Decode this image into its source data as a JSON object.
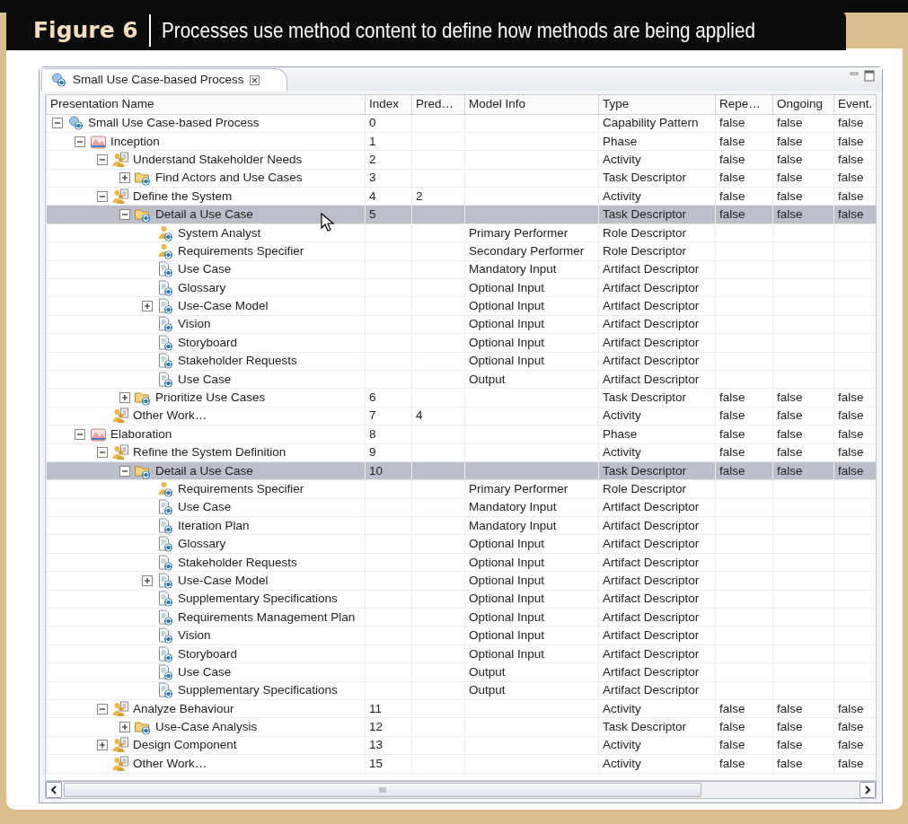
{
  "figure": {
    "label": "Figure 6",
    "caption": "Processes use method content to define how methods are being applied"
  },
  "editor_tab": {
    "title": "Small Use Case-based Process",
    "selected": true
  },
  "columns": [
    "Presentation Name",
    "Index",
    "Pred…",
    "Model Info",
    "Type",
    "Repe…",
    "Ongoing",
    "Event."
  ],
  "tree": [
    {
      "name": "Small Use Case-based Process",
      "kind": "process",
      "index": "0",
      "type": "Capability Pattern",
      "repeatable": "false",
      "ongoing": "false",
      "event": "false",
      "expanded": true,
      "selected": false,
      "children": [
        {
          "name": "Inception",
          "kind": "phase",
          "index": "1",
          "type": "Phase",
          "repeatable": "false",
          "ongoing": "false",
          "event": "false",
          "expanded": true,
          "selected": false,
          "children": [
            {
              "name": "Understand Stakeholder Needs",
              "kind": "activity",
              "index": "2",
              "type": "Activity",
              "repeatable": "false",
              "ongoing": "false",
              "event": "false",
              "expanded": true,
              "selected": false,
              "children": [
                {
                  "name": "Find Actors and Use Cases",
                  "kind": "task",
                  "index": "3",
                  "type": "Task Descriptor",
                  "repeatable": "false",
                  "ongoing": "false",
                  "event": "false",
                  "expanded": false,
                  "selected": false
                }
              ]
            },
            {
              "name": "Define the System",
              "kind": "activity",
              "index": "4",
              "pred": "2",
              "type": "Activity",
              "repeatable": "false",
              "ongoing": "false",
              "event": "false",
              "expanded": true,
              "selected": false,
              "children": [
                {
                  "name": "Detail a Use Case",
                  "kind": "task",
                  "index": "5",
                  "type": "Task Descriptor",
                  "repeatable": "false",
                  "ongoing": "false",
                  "event": "false",
                  "expanded": true,
                  "selected": true,
                  "children": [
                    {
                      "name": "System Analyst",
                      "kind": "role",
                      "model_info": "Primary Performer",
                      "type": "Role Descriptor",
                      "selected": false
                    },
                    {
                      "name": "Requirements Specifier",
                      "kind": "role",
                      "model_info": "Secondary Performer",
                      "type": "Role Descriptor",
                      "selected": false
                    },
                    {
                      "name": "Use Case",
                      "kind": "artifact",
                      "model_info": "Mandatory Input",
                      "type": "Artifact Descriptor",
                      "selected": false
                    },
                    {
                      "name": "Glossary",
                      "kind": "artifact",
                      "model_info": "Optional Input",
                      "type": "Artifact Descriptor",
                      "selected": false
                    },
                    {
                      "name": "Use-Case Model",
                      "kind": "artifact",
                      "model_info": "Optional Input",
                      "type": "Artifact Descriptor",
                      "expanded": false,
                      "selected": false
                    },
                    {
                      "name": "Vision",
                      "kind": "artifact",
                      "model_info": "Optional Input",
                      "type": "Artifact Descriptor",
                      "selected": false
                    },
                    {
                      "name": "Storyboard",
                      "kind": "artifact",
                      "model_info": "Optional Input",
                      "type": "Artifact Descriptor",
                      "selected": false
                    },
                    {
                      "name": "Stakeholder Requests",
                      "kind": "artifact",
                      "model_info": "Optional Input",
                      "type": "Artifact Descriptor",
                      "selected": false
                    },
                    {
                      "name": "Use Case",
                      "kind": "artifact",
                      "model_info": "Output",
                      "type": "Artifact Descriptor",
                      "selected": false
                    }
                  ]
                },
                {
                  "name": "Prioritize Use Cases",
                  "kind": "task",
                  "index": "6",
                  "type": "Task Descriptor",
                  "repeatable": "false",
                  "ongoing": "false",
                  "event": "false",
                  "expanded": false,
                  "selected": false
                }
              ]
            },
            {
              "name": "Other Work…",
              "kind": "activity",
              "index": "7",
              "pred": "4",
              "type": "Activity",
              "repeatable": "false",
              "ongoing": "false",
              "event": "false",
              "selected": false
            }
          ]
        },
        {
          "name": "Elaboration",
          "kind": "phase",
          "index": "8",
          "type": "Phase",
          "repeatable": "false",
          "ongoing": "false",
          "event": "false",
          "expanded": true,
          "selected": false,
          "children": [
            {
              "name": "Refine the System Definition",
              "kind": "activity",
              "index": "9",
              "type": "Activity",
              "repeatable": "false",
              "ongoing": "false",
              "event": "false",
              "expanded": true,
              "selected": false,
              "children": [
                {
                  "name": "Detail a Use Case",
                  "kind": "task",
                  "index": "10",
                  "type": "Task Descriptor",
                  "repeatable": "false",
                  "ongoing": "false",
                  "event": "false",
                  "expanded": true,
                  "selected": true,
                  "children": [
                    {
                      "name": "Requirements Specifier",
                      "kind": "role",
                      "model_info": "Primary Performer",
                      "type": "Role Descriptor",
                      "selected": false
                    },
                    {
                      "name": "Use Case",
                      "kind": "artifact",
                      "model_info": "Mandatory Input",
                      "type": "Artifact Descriptor",
                      "selected": false
                    },
                    {
                      "name": "Iteration Plan",
                      "kind": "artifact",
                      "model_info": "Mandatory Input",
                      "type": "Artifact Descriptor",
                      "selected": false
                    },
                    {
                      "name": "Glossary",
                      "kind": "artifact",
                      "model_info": "Optional Input",
                      "type": "Artifact Descriptor",
                      "selected": false
                    },
                    {
                      "name": "Stakeholder Requests",
                      "kind": "artifact",
                      "model_info": "Optional Input",
                      "type": "Artifact Descriptor",
                      "selected": false
                    },
                    {
                      "name": "Use-Case Model",
                      "kind": "artifact",
                      "model_info": "Optional Input",
                      "type": "Artifact Descriptor",
                      "expanded": false,
                      "selected": false
                    },
                    {
                      "name": "Supplementary Specifications",
                      "kind": "artifact",
                      "model_info": "Optional Input",
                      "type": "Artifact Descriptor",
                      "selected": false
                    },
                    {
                      "name": "Requirements Management Plan",
                      "kind": "artifact",
                      "model_info": "Optional Input",
                      "type": "Artifact Descriptor",
                      "selected": false
                    },
                    {
                      "name": "Vision",
                      "kind": "artifact",
                      "model_info": "Optional Input",
                      "type": "Artifact Descriptor",
                      "selected": false
                    },
                    {
                      "name": "Storyboard",
                      "kind": "artifact",
                      "model_info": "Optional Input",
                      "type": "Artifact Descriptor",
                      "selected": false
                    },
                    {
                      "name": "Use Case",
                      "kind": "artifact",
                      "model_info": "Output",
                      "type": "Artifact Descriptor",
                      "selected": false
                    },
                    {
                      "name": "Supplementary Specifications",
                      "kind": "artifact",
                      "model_info": "Output",
                      "type": "Artifact Descriptor",
                      "selected": false
                    }
                  ]
                }
              ]
            },
            {
              "name": "Analyze Behaviour",
              "kind": "activity",
              "index": "11",
              "type": "Activity",
              "repeatable": "false",
              "ongoing": "false",
              "event": "false",
              "expanded": true,
              "selected": false,
              "children": [
                {
                  "name": "Use-Case Analysis",
                  "kind": "task",
                  "index": "12",
                  "type": "Task Descriptor",
                  "repeatable": "false",
                  "ongoing": "false",
                  "event": "false",
                  "expanded": false,
                  "selected": false
                }
              ]
            },
            {
              "name": "Design Component",
              "kind": "activity",
              "index": "13",
              "type": "Activity",
              "repeatable": "false",
              "ongoing": "false",
              "event": "false",
              "expanded": false,
              "selected": false
            },
            {
              "name": "Other Work…",
              "kind": "activity",
              "index": "15",
              "type": "Activity",
              "repeatable": "false",
              "ongoing": "false",
              "event": "false",
              "selected": false
            }
          ]
        }
      ]
    }
  ]
}
